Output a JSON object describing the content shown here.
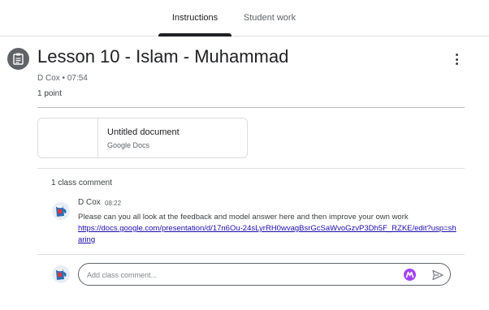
{
  "tabs": {
    "instructions": "Instructions",
    "student_work": "Student work"
  },
  "assignment": {
    "title": "Lesson 10 - Islam - Muhammad",
    "meta": "D Cox • 07:54",
    "points": "1 point"
  },
  "attachment": {
    "title": "Untitled document",
    "type": "Google Docs"
  },
  "comments": {
    "count_label": "1 class comment",
    "items": [
      {
        "author": "D Cox",
        "time": "08:22",
        "text": "Please can you all look at the feedback and model answer here and then improve your own work",
        "link": "https://docs.google.com/presentation/d/17n6Ou-24sLyrRH0wvagBsrGcSaWvoGzvP3Dh5F_RZKE/edit?usp=sharing"
      }
    ],
    "input_placeholder": "Add class comment..."
  },
  "colors": {
    "accent": "#202124",
    "link": "#1a0dab",
    "extension": "#a142f4"
  },
  "icons": {
    "assignment": "assignment-icon",
    "more": "more-vert-icon",
    "extension": "extension-icon",
    "send": "send-icon"
  }
}
